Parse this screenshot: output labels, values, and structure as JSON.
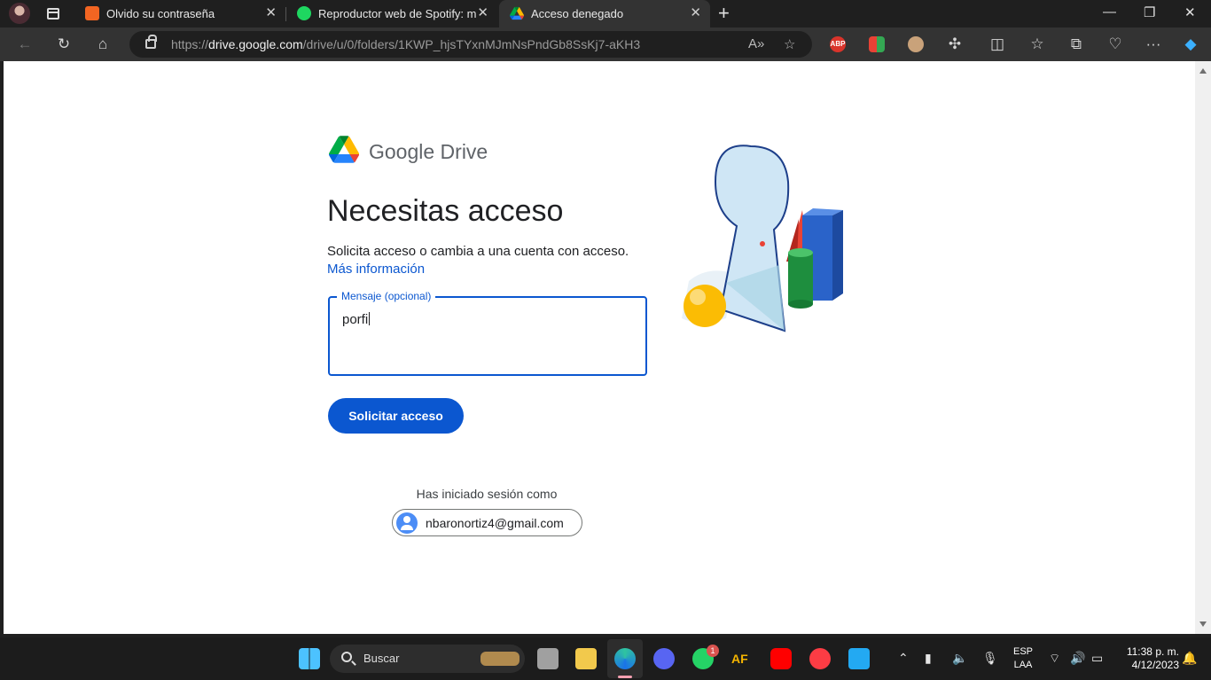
{
  "browser": {
    "tabs": [
      {
        "title": "Olvido su contraseña",
        "active": false
      },
      {
        "title": "Reproductor web de Spotify: mú",
        "active": false
      },
      {
        "title": "Acceso denegado",
        "active": true
      }
    ],
    "url": {
      "scheme": "https://",
      "host": "drive.google.com",
      "path": "/drive/u/0/folders/1KWP_hjsTYxnMJmNsPndGb8SsKj7-aKH3"
    },
    "extensions": [
      "ABP"
    ]
  },
  "page": {
    "brand": "Google Drive",
    "heading": "Necesitas acceso",
    "description": "Solicita acceso o cambia a una cuenta con acceso.",
    "more_link": "Más información",
    "message_label": "Mensaje (opcional)",
    "message_value": "porfi",
    "request_button": "Solicitar acceso",
    "signed_in_label": "Has iniciado sesión como",
    "account_email": "nbaronortiz4@gmail.com"
  },
  "taskbar": {
    "search_label": "Buscar",
    "whatsapp_badge": "1",
    "language": "ESP",
    "layout": "LAA",
    "time": "11:38 p. m.",
    "date": "4/12/2023"
  }
}
